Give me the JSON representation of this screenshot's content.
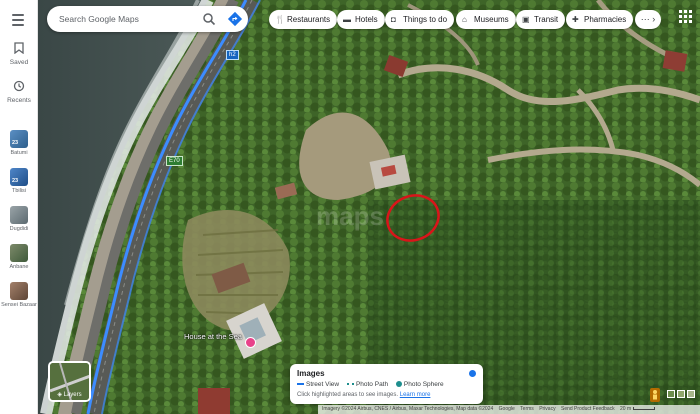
{
  "search": {
    "placeholder": "Search Google Maps",
    "search_icon": "search-icon",
    "directions_icon": "directions-icon"
  },
  "rail": {
    "menu_icon": "menu-icon",
    "saved_label": "Saved",
    "recents_label": "Recents",
    "recent_places": [
      {
        "name": "Batumi",
        "temp": "23"
      },
      {
        "name": "Tbilisi",
        "temp": "23"
      },
      {
        "name": "Dugdidi",
        "temp": ""
      },
      {
        "name": "Anbane",
        "temp": ""
      },
      {
        "name": "Sensei Bazaar",
        "temp": ""
      }
    ]
  },
  "chips": [
    {
      "label": "Restaurants",
      "icon": "fork-knife-icon"
    },
    {
      "label": "Hotels",
      "icon": "bed-icon"
    },
    {
      "label": "Things to do",
      "icon": "camera-icon"
    },
    {
      "label": "Museums",
      "icon": "museum-icon"
    },
    {
      "label": "Transit",
      "icon": "train-icon"
    },
    {
      "label": "Pharmacies",
      "icon": "pharmacy-icon"
    }
  ],
  "map": {
    "place_label": "House at the Sea",
    "road_shields": [
      "E70",
      "h2"
    ]
  },
  "layers": {
    "label": "Layers"
  },
  "images_panel": {
    "title": "Images",
    "street_view": "Street View",
    "photo_path": "Photo Path",
    "photo_sphere": "Photo Sphere",
    "hint": "Click highlighted areas to see images.",
    "learn_more": "Learn more"
  },
  "attribution": {
    "imagery": "Imagery ©2024 Airbus, CNES / Airbus, Maxar Technologies, Map data ©2024",
    "links": [
      "Google",
      "Terms",
      "Privacy",
      "Send Product Feedback"
    ],
    "scale": "20 m"
  },
  "colors": {
    "accent": "#1a73e8",
    "annotation": "#d9151a",
    "pin": "#e8428a"
  }
}
